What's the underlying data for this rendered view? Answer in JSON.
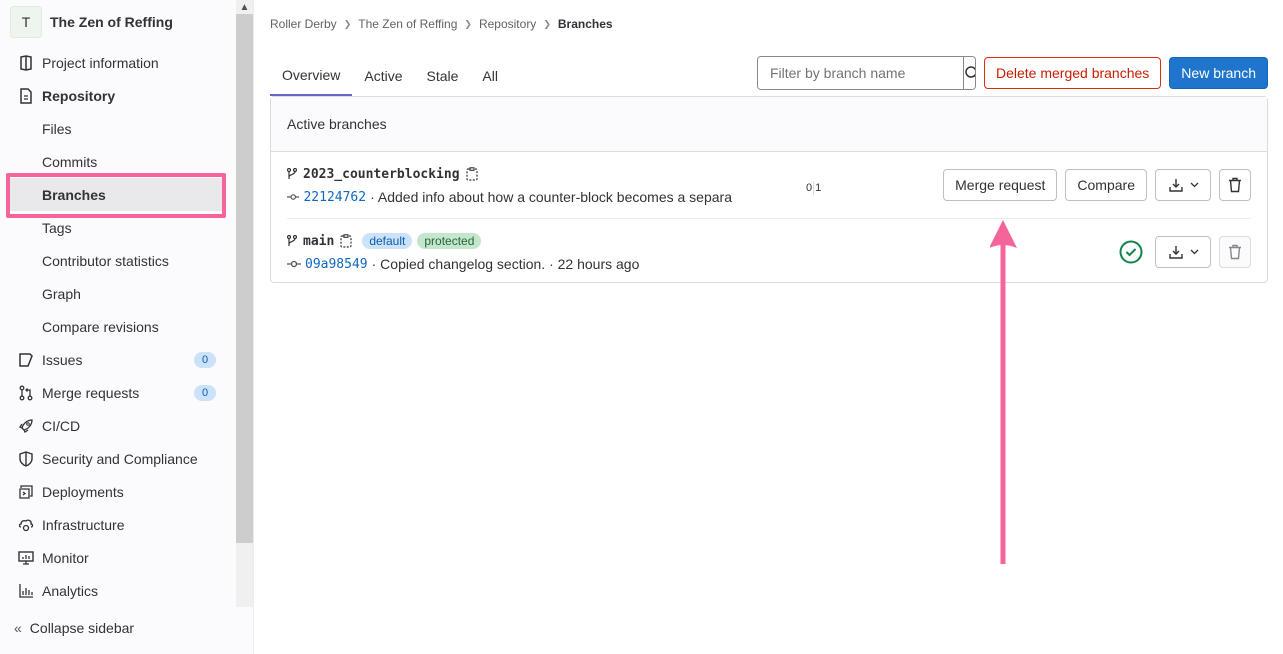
{
  "sidebar": {
    "project_initial": "T",
    "project_name": "The Zen of Reffing",
    "items": [
      {
        "label": "Project information",
        "icon": "project-icon"
      },
      {
        "label": "Repository",
        "icon": "document-icon"
      },
      {
        "label": "Files"
      },
      {
        "label": "Commits"
      },
      {
        "label": "Branches"
      },
      {
        "label": "Tags"
      },
      {
        "label": "Contributor statistics"
      },
      {
        "label": "Graph"
      },
      {
        "label": "Compare revisions"
      },
      {
        "label": "Issues",
        "icon": "issues-icon",
        "count": "0"
      },
      {
        "label": "Merge requests",
        "icon": "merge-request-icon",
        "count": "0"
      },
      {
        "label": "CI/CD",
        "icon": "rocket-icon"
      },
      {
        "label": "Security and Compliance",
        "icon": "shield-icon"
      },
      {
        "label": "Deployments",
        "icon": "deployments-icon"
      },
      {
        "label": "Infrastructure",
        "icon": "cloud-gear-icon"
      },
      {
        "label": "Monitor",
        "icon": "monitor-icon"
      },
      {
        "label": "Analytics",
        "icon": "chart-icon"
      }
    ],
    "collapse_label": "Collapse sidebar"
  },
  "breadcrumb": [
    "Roller Derby",
    "The Zen of Reffing",
    "Repository",
    "Branches"
  ],
  "tabs": [
    "Overview",
    "Active",
    "Stale",
    "All"
  ],
  "toolbar": {
    "search_placeholder": "Filter by branch name",
    "delete_merged_label": "Delete merged branches",
    "new_branch_label": "New branch"
  },
  "card": {
    "title": "Active branches",
    "branches": [
      {
        "name": "2023_counterblocking",
        "sha": "22124762",
        "message": "· Added info about how a counter-block becomes a separa",
        "behind": "0",
        "ahead": "1",
        "merge_request_label": "Merge request",
        "compare_label": "Compare"
      },
      {
        "name": "main",
        "sha": "09a98549",
        "message": "· Copied changelog section. · 22 hours ago",
        "labels": [
          "default",
          "protected"
        ],
        "pipeline_status": "passed"
      }
    ]
  },
  "colors": {
    "accent": "#1f75cb",
    "danger": "#dd2b0e",
    "highlight": "#f5649a",
    "success": "#108548"
  }
}
